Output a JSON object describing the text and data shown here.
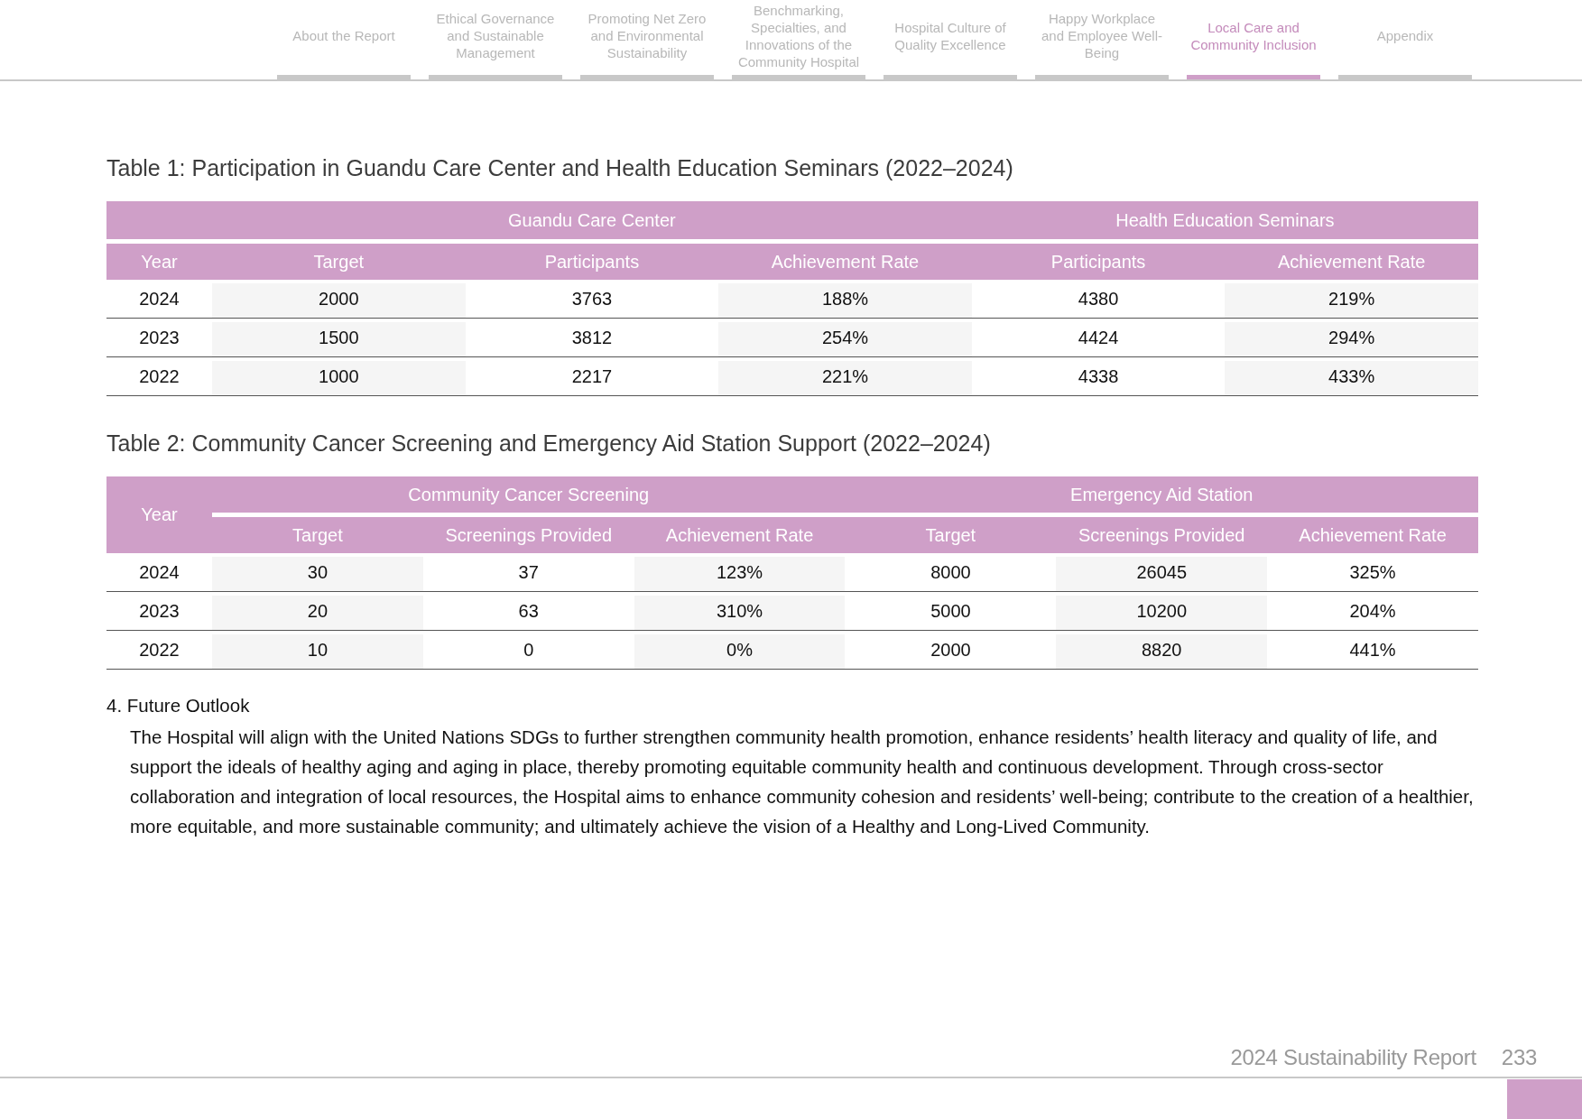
{
  "nav": {
    "tabs": [
      {
        "label": "About the Report",
        "selected": false
      },
      {
        "label": "Ethical Governance and Sustainable Management",
        "selected": false
      },
      {
        "label": "Promoting Net Zero and Environmental Sustainability",
        "selected": false
      },
      {
        "label": "Benchmarking, Specialties, and Innovations of the Community Hospital",
        "selected": false
      },
      {
        "label": "Hospital Culture of Quality Excellence",
        "selected": false
      },
      {
        "label": "Happy Workplace and Employee Well-Being",
        "selected": false
      },
      {
        "label": "Local Care and Community Inclusion",
        "selected": true
      },
      {
        "label": "Appendix",
        "selected": false
      }
    ]
  },
  "tables": [
    {
      "title": "Table 1: Participation in Guandu Care Center and Health Education Seminars (2022–2024)",
      "kind": "year-below",
      "lead_column": "Year",
      "groups": [
        {
          "label": "Guandu Care Center",
          "columns": [
            "Target",
            "Participants",
            "Achievement Rate"
          ]
        },
        {
          "label": "Health Education Seminars",
          "columns": [
            "Participants",
            "Achievement Rate"
          ]
        }
      ],
      "rows": [
        [
          "2024",
          "2000",
          "3763",
          "188%",
          "4380",
          "219%"
        ],
        [
          "2023",
          "1500",
          "3812",
          "254%",
          "4424",
          "294%"
        ],
        [
          "2022",
          "1000",
          "2217",
          "221%",
          "4338",
          "433%"
        ]
      ]
    },
    {
      "title": "Table 2: Community Cancer Screening and Emergency Aid Station Support (2022–2024)",
      "kind": "year-spanning",
      "lead_column": "Year",
      "groups": [
        {
          "label": "Community Cancer Screening",
          "columns": [
            "Target",
            "Screenings Provided",
            "Achievement Rate"
          ]
        },
        {
          "label": "Emergency Aid Station",
          "columns": [
            "Target",
            "Screenings Provided",
            "Achievement Rate"
          ]
        }
      ],
      "rows": [
        [
          "2024",
          "30",
          "37",
          "123%",
          "8000",
          "26045",
          "325%"
        ],
        [
          "2023",
          "20",
          "63",
          "310%",
          "5000",
          "10200",
          "204%"
        ],
        [
          "2022",
          "10",
          "0",
          "0%",
          "2000",
          "8820",
          "441%"
        ]
      ]
    }
  ],
  "outlook": {
    "heading": "4. Future Outlook",
    "text": "The Hospital will align with the United Nations SDGs to further strengthen community health promotion, enhance residents’ health literacy and quality of life, and support the ideals of healthy aging and aging in place, thereby promoting equitable community health and continuous development. Through cross-sector collaboration and integration of local resources, the Hospital aims to enhance community cohesion and residents’ well-being; contribute to the creation of a healthier, more equitable, and more sustainable community; and ultimately achieve the vision of a Healthy and Long-Lived Community."
  },
  "footer": {
    "report": "2024 Sustainability Report",
    "page": "233"
  }
}
